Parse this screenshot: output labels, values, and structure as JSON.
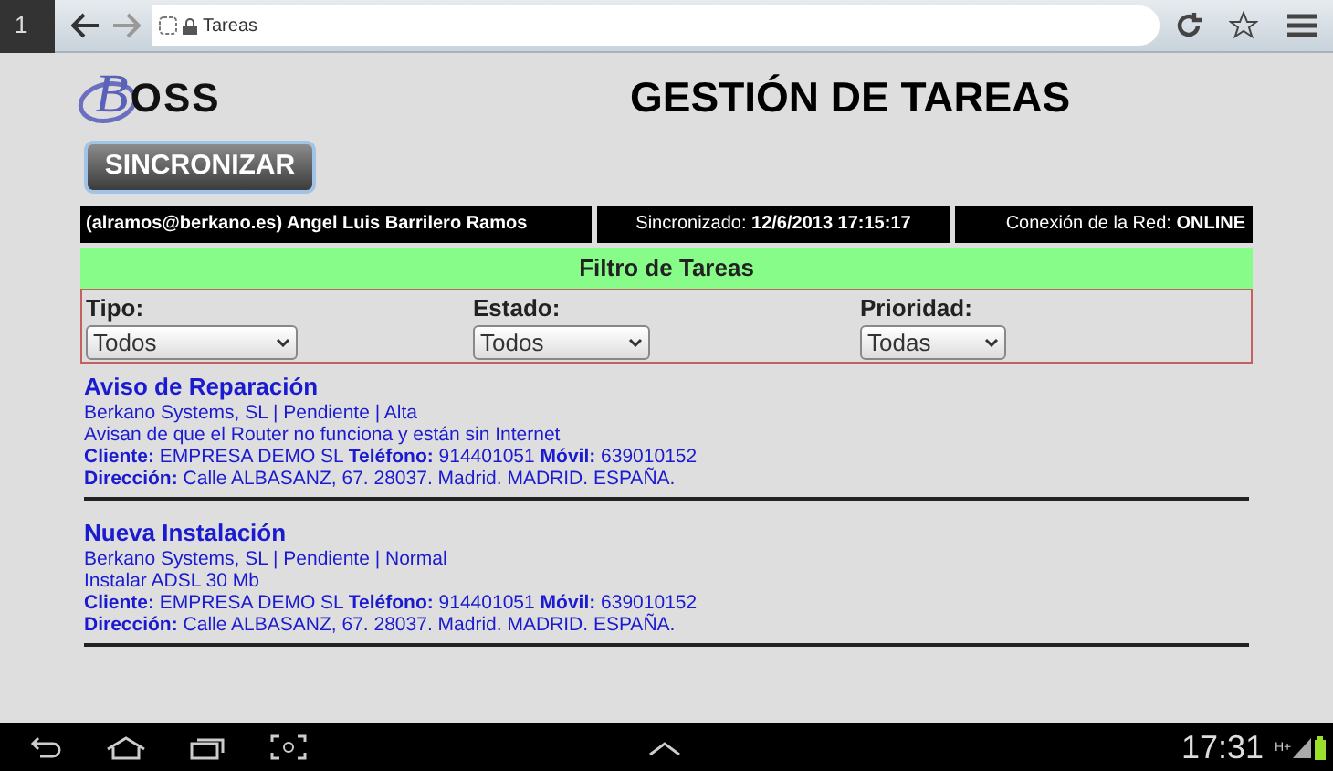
{
  "browser": {
    "tab_count": "1",
    "address": "Tareas"
  },
  "header": {
    "logo": "BOSS",
    "title": "GESTIÓN DE TAREAS",
    "sync_button": "SINCRONIZAR"
  },
  "info_bar": [
    "(alramos@berkano.es) Angel Luis Barrilero Ramos",
    "Sincronizado: **12/6/2013 17:15:17**",
    "Conexión de la Red: **ONLINE**"
  ],
  "filter": {
    "title": "Filtro de Tareas",
    "fields": [
      {
        "label": "Tipo:",
        "value": "Todos"
      },
      {
        "label": "Estado:",
        "value": "Todos"
      },
      {
        "label": "Prioridad:",
        "value": "Todas"
      }
    ]
  },
  "tasks": [
    {
      "title": "Aviso de Reparación",
      "lines": [
        "Berkano Systems, SL | Pendiente | Alta",
        "Avisan de que el Router no funciona y están sin Internet",
        "**Cliente:** EMPRESA DEMO SL **Teléfono:** 914401051 **Móvil:** 639010152",
        "**Dirección:** Calle ALBASANZ, 67. 28037. Madrid. MADRID. ESPAÑA."
      ]
    },
    {
      "title": "Nueva Instalación",
      "lines": [
        "Berkano Systems, SL | Pendiente | Normal",
        "Instalar ADSL 30 Mb",
        "**Cliente:** EMPRESA DEMO SL **Teléfono:** 914401051 **Móvil:** 639010152",
        "**Dirección:** Calle ALBASANZ, 67. 28037. Madrid. MADRID. ESPAÑA."
      ]
    }
  ],
  "status_bar": {
    "time": "17:31",
    "network_type": "H+"
  }
}
